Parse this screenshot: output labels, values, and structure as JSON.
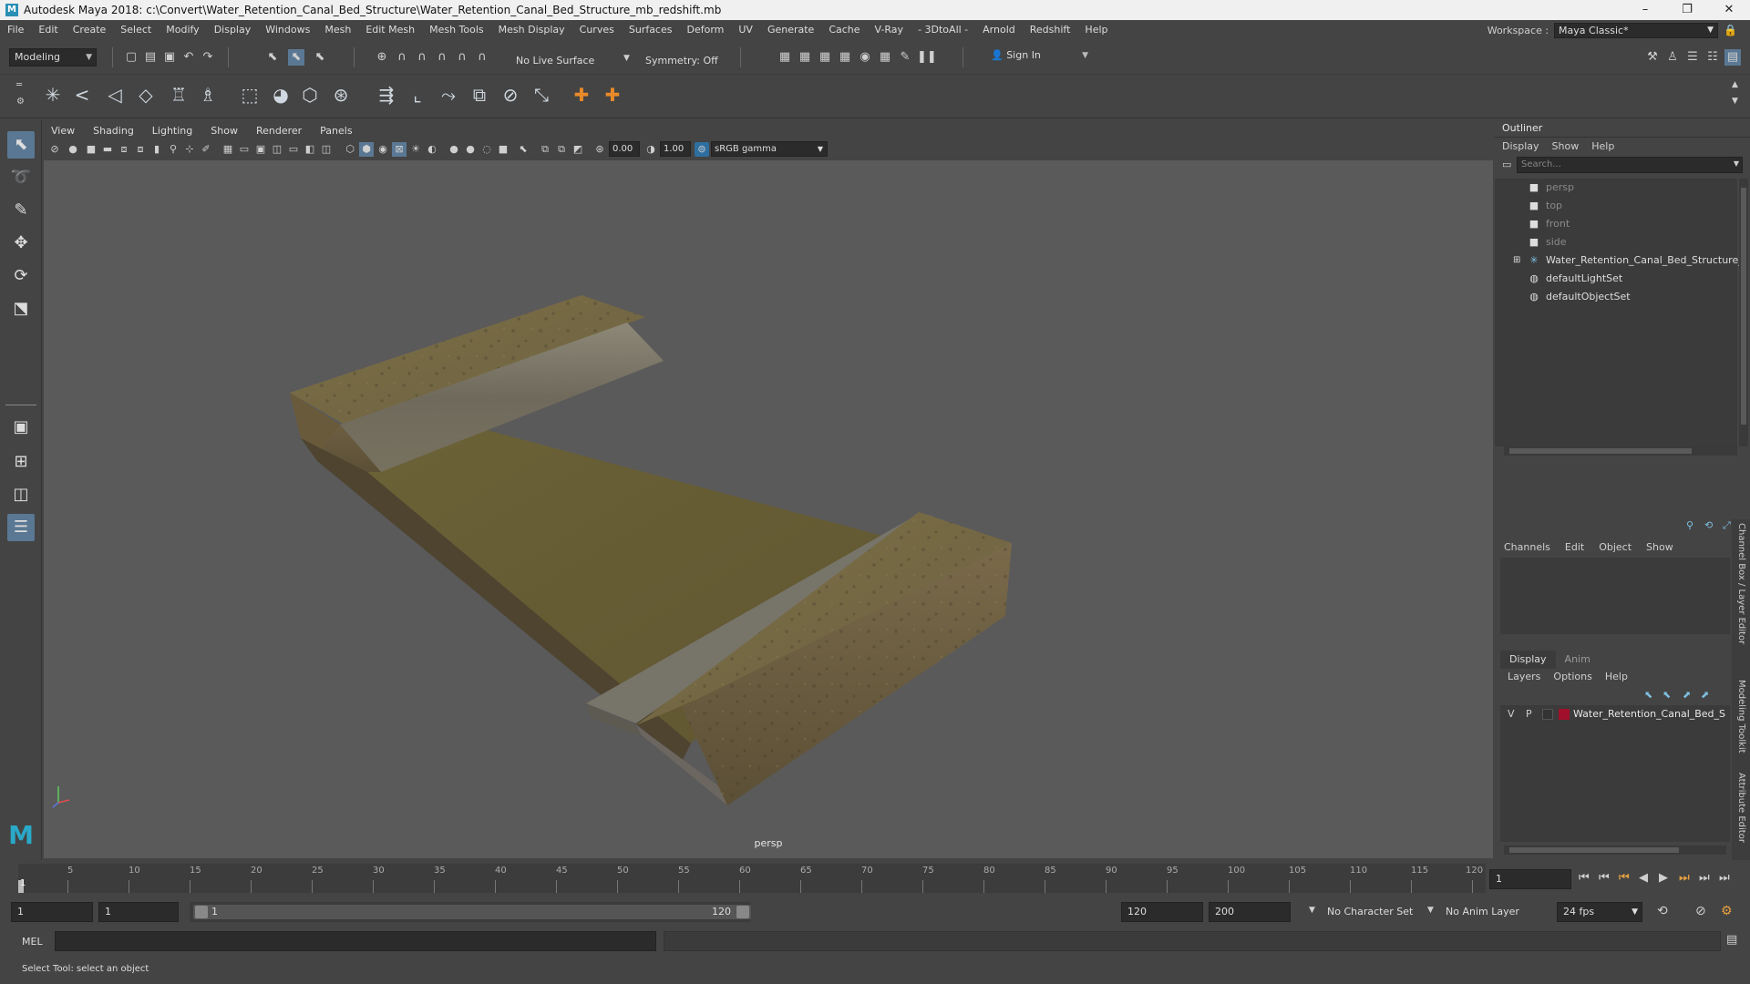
{
  "window": {
    "title": "Autodesk Maya 2018: c:\\Convert\\Water_Retention_Canal_Bed_Structure\\Water_Retention_Canal_Bed_Structure_mb_redshift.mb",
    "minimize": "–",
    "maximize": "❐",
    "close": "✕"
  },
  "menubar": {
    "items": [
      "File",
      "Edit",
      "Create",
      "Select",
      "Modify",
      "Display",
      "Windows",
      "Mesh",
      "Edit Mesh",
      "Mesh Tools",
      "Mesh Display",
      "Curves",
      "Surfaces",
      "Deform",
      "UV",
      "Generate",
      "Cache",
      "V-Ray",
      "- 3DtoAll -",
      "Arnold",
      "Redshift",
      "Help"
    ],
    "workspace_label": "Workspace :",
    "workspace_value": "Maya Classic*"
  },
  "statusline": {
    "mode": "Modeling",
    "live_surface": "No Live Surface",
    "symmetry": "Symmetry: Off",
    "sign_in": "Sign In"
  },
  "viewport": {
    "menus": [
      "View",
      "Shading",
      "Lighting",
      "Show",
      "Renderer",
      "Panels"
    ],
    "exposure": "0.00",
    "gamma": "1.00",
    "color_space": "sRGB gamma",
    "camera_label": "persp"
  },
  "outliner": {
    "title": "Outliner",
    "menus": [
      "Display",
      "Show",
      "Help"
    ],
    "search_placeholder": "Search...",
    "items": [
      {
        "label": "persp",
        "icon": "camera-icon",
        "dim": true
      },
      {
        "label": "top",
        "icon": "camera-icon",
        "dim": true
      },
      {
        "label": "front",
        "icon": "camera-icon",
        "dim": true
      },
      {
        "label": "side",
        "icon": "camera-icon",
        "dim": true
      },
      {
        "label": "Water_Retention_Canal_Bed_Structure_",
        "icon": "group-icon",
        "dim": false
      },
      {
        "label": "defaultLightSet",
        "icon": "set-icon",
        "dim": false
      },
      {
        "label": "defaultObjectSet",
        "icon": "set-icon",
        "dim": false
      }
    ]
  },
  "channelbox": {
    "menus": [
      "Channels",
      "Edit",
      "Object",
      "Show"
    ],
    "tabs": [
      "Display",
      "Anim"
    ],
    "layer_menus": [
      "Layers",
      "Options",
      "Help"
    ],
    "layer": {
      "v": "V",
      "p": "P",
      "name": "Water_Retention_Canal_Bed_S",
      "color": "#a0102a"
    },
    "side_tabs": [
      "Channel Box / Layer Editor",
      "Modeling Toolkit",
      "Attribute Editor"
    ]
  },
  "timeslider": {
    "ticks": [
      "1",
      "5",
      "10",
      "15",
      "20",
      "25",
      "30",
      "35",
      "40",
      "45",
      "50",
      "55",
      "60",
      "65",
      "70",
      "75",
      "80",
      "85",
      "90",
      "95",
      "100",
      "105",
      "110",
      "115",
      "120"
    ],
    "current_frame": "1"
  },
  "rangeslider": {
    "start": "1",
    "playback_start": "1",
    "range_start": "1",
    "range_end": "120",
    "playback_end": "120",
    "end": "200",
    "character_set": "No Character Set",
    "anim_layer": "No Anim Layer",
    "fps": "24 fps"
  },
  "commandline": {
    "language": "MEL"
  },
  "helpline": {
    "text": "Select Tool: select an object"
  }
}
